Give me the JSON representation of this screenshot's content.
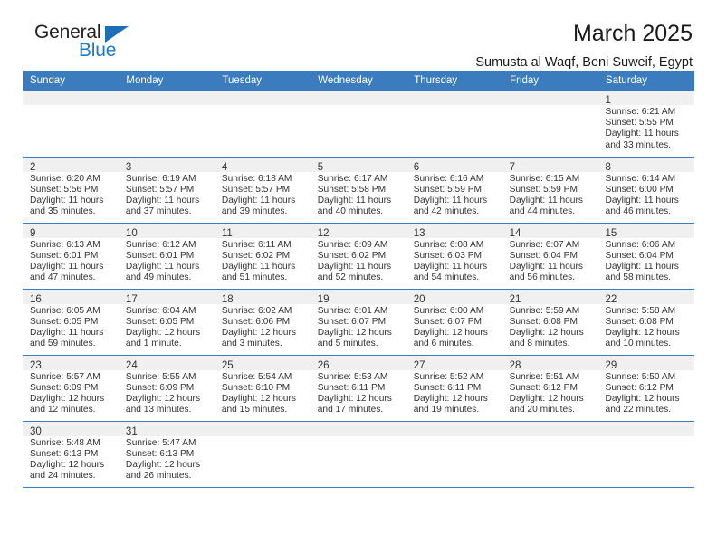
{
  "brand": {
    "name_part1": "General",
    "name_part2": "Blue",
    "triangle_color": "#1f6fb8",
    "blue_color": "#1f7cc0"
  },
  "header": {
    "title": "March 2025",
    "subtitle": "Sumusta al Waqf, Beni Suweif, Egypt"
  },
  "theme": {
    "header_bg": "#3a7cbe",
    "daynum_bg": "#f0f0f0",
    "row_border": "#3a7cbe"
  },
  "weekdays": [
    "Sunday",
    "Monday",
    "Tuesday",
    "Wednesday",
    "Thursday",
    "Friday",
    "Saturday"
  ],
  "weeks": [
    [
      {
        "day": "",
        "blank": true
      },
      {
        "day": "",
        "blank": true
      },
      {
        "day": "",
        "blank": true
      },
      {
        "day": "",
        "blank": true
      },
      {
        "day": "",
        "blank": true
      },
      {
        "day": "",
        "blank": true
      },
      {
        "day": "1",
        "sunrise": "Sunrise: 6:21 AM",
        "sunset": "Sunset: 5:55 PM",
        "daylight1": "Daylight: 11 hours",
        "daylight2": "and 33 minutes."
      }
    ],
    [
      {
        "day": "2",
        "sunrise": "Sunrise: 6:20 AM",
        "sunset": "Sunset: 5:56 PM",
        "daylight1": "Daylight: 11 hours",
        "daylight2": "and 35 minutes."
      },
      {
        "day": "3",
        "sunrise": "Sunrise: 6:19 AM",
        "sunset": "Sunset: 5:57 PM",
        "daylight1": "Daylight: 11 hours",
        "daylight2": "and 37 minutes."
      },
      {
        "day": "4",
        "sunrise": "Sunrise: 6:18 AM",
        "sunset": "Sunset: 5:57 PM",
        "daylight1": "Daylight: 11 hours",
        "daylight2": "and 39 minutes."
      },
      {
        "day": "5",
        "sunrise": "Sunrise: 6:17 AM",
        "sunset": "Sunset: 5:58 PM",
        "daylight1": "Daylight: 11 hours",
        "daylight2": "and 40 minutes."
      },
      {
        "day": "6",
        "sunrise": "Sunrise: 6:16 AM",
        "sunset": "Sunset: 5:59 PM",
        "daylight1": "Daylight: 11 hours",
        "daylight2": "and 42 minutes."
      },
      {
        "day": "7",
        "sunrise": "Sunrise: 6:15 AM",
        "sunset": "Sunset: 5:59 PM",
        "daylight1": "Daylight: 11 hours",
        "daylight2": "and 44 minutes."
      },
      {
        "day": "8",
        "sunrise": "Sunrise: 6:14 AM",
        "sunset": "Sunset: 6:00 PM",
        "daylight1": "Daylight: 11 hours",
        "daylight2": "and 46 minutes."
      }
    ],
    [
      {
        "day": "9",
        "sunrise": "Sunrise: 6:13 AM",
        "sunset": "Sunset: 6:01 PM",
        "daylight1": "Daylight: 11 hours",
        "daylight2": "and 47 minutes."
      },
      {
        "day": "10",
        "sunrise": "Sunrise: 6:12 AM",
        "sunset": "Sunset: 6:01 PM",
        "daylight1": "Daylight: 11 hours",
        "daylight2": "and 49 minutes."
      },
      {
        "day": "11",
        "sunrise": "Sunrise: 6:11 AM",
        "sunset": "Sunset: 6:02 PM",
        "daylight1": "Daylight: 11 hours",
        "daylight2": "and 51 minutes."
      },
      {
        "day": "12",
        "sunrise": "Sunrise: 6:09 AM",
        "sunset": "Sunset: 6:02 PM",
        "daylight1": "Daylight: 11 hours",
        "daylight2": "and 52 minutes."
      },
      {
        "day": "13",
        "sunrise": "Sunrise: 6:08 AM",
        "sunset": "Sunset: 6:03 PM",
        "daylight1": "Daylight: 11 hours",
        "daylight2": "and 54 minutes."
      },
      {
        "day": "14",
        "sunrise": "Sunrise: 6:07 AM",
        "sunset": "Sunset: 6:04 PM",
        "daylight1": "Daylight: 11 hours",
        "daylight2": "and 56 minutes."
      },
      {
        "day": "15",
        "sunrise": "Sunrise: 6:06 AM",
        "sunset": "Sunset: 6:04 PM",
        "daylight1": "Daylight: 11 hours",
        "daylight2": "and 58 minutes."
      }
    ],
    [
      {
        "day": "16",
        "sunrise": "Sunrise: 6:05 AM",
        "sunset": "Sunset: 6:05 PM",
        "daylight1": "Daylight: 11 hours",
        "daylight2": "and 59 minutes."
      },
      {
        "day": "17",
        "sunrise": "Sunrise: 6:04 AM",
        "sunset": "Sunset: 6:05 PM",
        "daylight1": "Daylight: 12 hours",
        "daylight2": "and 1 minute."
      },
      {
        "day": "18",
        "sunrise": "Sunrise: 6:02 AM",
        "sunset": "Sunset: 6:06 PM",
        "daylight1": "Daylight: 12 hours",
        "daylight2": "and 3 minutes."
      },
      {
        "day": "19",
        "sunrise": "Sunrise: 6:01 AM",
        "sunset": "Sunset: 6:07 PM",
        "daylight1": "Daylight: 12 hours",
        "daylight2": "and 5 minutes."
      },
      {
        "day": "20",
        "sunrise": "Sunrise: 6:00 AM",
        "sunset": "Sunset: 6:07 PM",
        "daylight1": "Daylight: 12 hours",
        "daylight2": "and 6 minutes."
      },
      {
        "day": "21",
        "sunrise": "Sunrise: 5:59 AM",
        "sunset": "Sunset: 6:08 PM",
        "daylight1": "Daylight: 12 hours",
        "daylight2": "and 8 minutes."
      },
      {
        "day": "22",
        "sunrise": "Sunrise: 5:58 AM",
        "sunset": "Sunset: 6:08 PM",
        "daylight1": "Daylight: 12 hours",
        "daylight2": "and 10 minutes."
      }
    ],
    [
      {
        "day": "23",
        "sunrise": "Sunrise: 5:57 AM",
        "sunset": "Sunset: 6:09 PM",
        "daylight1": "Daylight: 12 hours",
        "daylight2": "and 12 minutes."
      },
      {
        "day": "24",
        "sunrise": "Sunrise: 5:55 AM",
        "sunset": "Sunset: 6:09 PM",
        "daylight1": "Daylight: 12 hours",
        "daylight2": "and 13 minutes."
      },
      {
        "day": "25",
        "sunrise": "Sunrise: 5:54 AM",
        "sunset": "Sunset: 6:10 PM",
        "daylight1": "Daylight: 12 hours",
        "daylight2": "and 15 minutes."
      },
      {
        "day": "26",
        "sunrise": "Sunrise: 5:53 AM",
        "sunset": "Sunset: 6:11 PM",
        "daylight1": "Daylight: 12 hours",
        "daylight2": "and 17 minutes."
      },
      {
        "day": "27",
        "sunrise": "Sunrise: 5:52 AM",
        "sunset": "Sunset: 6:11 PM",
        "daylight1": "Daylight: 12 hours",
        "daylight2": "and 19 minutes."
      },
      {
        "day": "28",
        "sunrise": "Sunrise: 5:51 AM",
        "sunset": "Sunset: 6:12 PM",
        "daylight1": "Daylight: 12 hours",
        "daylight2": "and 20 minutes."
      },
      {
        "day": "29",
        "sunrise": "Sunrise: 5:50 AM",
        "sunset": "Sunset: 6:12 PM",
        "daylight1": "Daylight: 12 hours",
        "daylight2": "and 22 minutes."
      }
    ],
    [
      {
        "day": "30",
        "sunrise": "Sunrise: 5:48 AM",
        "sunset": "Sunset: 6:13 PM",
        "daylight1": "Daylight: 12 hours",
        "daylight2": "and 24 minutes."
      },
      {
        "day": "31",
        "sunrise": "Sunrise: 5:47 AM",
        "sunset": "Sunset: 6:13 PM",
        "daylight1": "Daylight: 12 hours",
        "daylight2": "and 26 minutes."
      },
      {
        "day": "",
        "blank": true
      },
      {
        "day": "",
        "blank": true
      },
      {
        "day": "",
        "blank": true
      },
      {
        "day": "",
        "blank": true
      },
      {
        "day": "",
        "blank": true
      }
    ]
  ]
}
